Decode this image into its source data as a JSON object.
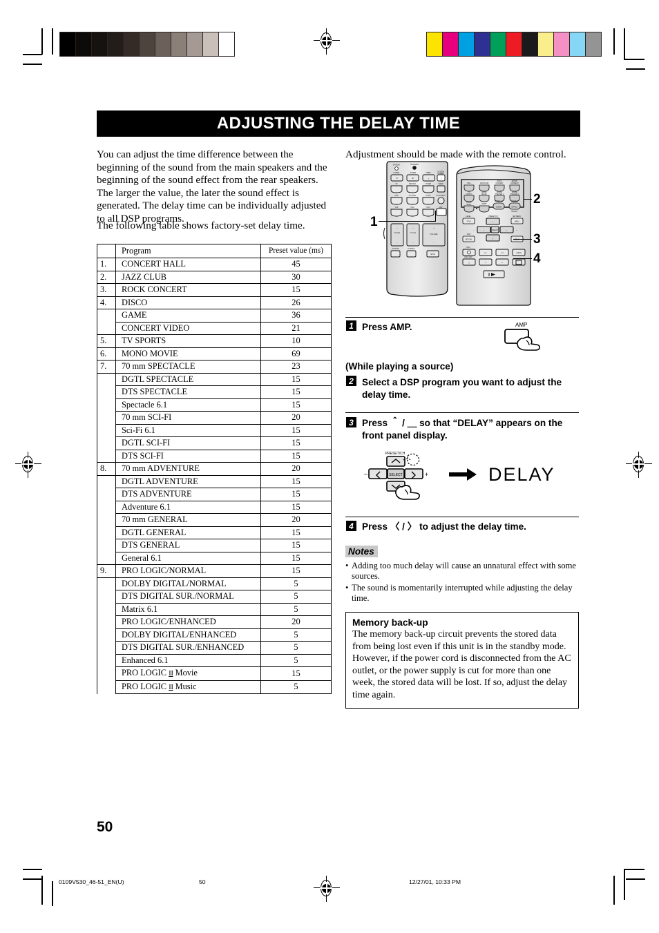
{
  "page": {
    "title": "ADJUSTING THE DELAY TIME",
    "number": "50"
  },
  "intro": {
    "paragraph1": "You can adjust the time difference between the beginning of the sound from the main speakers and the beginning of the sound effect from the rear speakers. The larger the value, the later the sound effect is generated. The delay time can be individually adjusted to all DSP programs.",
    "paragraph2": "The following table shows factory-set delay time.",
    "remote_note": "Adjustment should be made with the remote control."
  },
  "table": {
    "headers": [
      "",
      "Program",
      "Preset value (ms)"
    ],
    "rows": [
      {
        "num": "1.",
        "program": "CONCERT HALL",
        "value": "45"
      },
      {
        "num": "2.",
        "program": "JAZZ CLUB",
        "value": "30"
      },
      {
        "num": "3.",
        "program": "ROCK CONCERT",
        "value": "15"
      },
      {
        "num": "4.",
        "program": "DISCO",
        "value": "26"
      },
      {
        "num": "",
        "program": "GAME",
        "value": "36"
      },
      {
        "num": "",
        "program": "CONCERT VIDEO",
        "value": "21"
      },
      {
        "num": "5.",
        "program": "TV SPORTS",
        "value": "10"
      },
      {
        "num": "6.",
        "program": "MONO MOVIE",
        "value": "69"
      },
      {
        "num": "7.",
        "program": "70 mm SPECTACLE",
        "value": "23"
      },
      {
        "num": "",
        "program": "DGTL SPECTACLE",
        "value": "15"
      },
      {
        "num": "",
        "program": "DTS SPECTACLE",
        "value": "15"
      },
      {
        "num": "",
        "program": "Spectacle 6.1",
        "value": "15"
      },
      {
        "num": "",
        "program": "70 mm SCI-FI",
        "value": "20"
      },
      {
        "num": "",
        "program": "Sci-Fi 6.1",
        "value": "15"
      },
      {
        "num": "",
        "program": "DGTL SCI-FI",
        "value": "15"
      },
      {
        "num": "",
        "program": "DTS SCI-FI",
        "value": "15"
      },
      {
        "num": "8.",
        "program": "70 mm ADVENTURE",
        "value": "20"
      },
      {
        "num": "",
        "program": "DGTL ADVENTURE",
        "value": "15"
      },
      {
        "num": "",
        "program": "DTS ADVENTURE",
        "value": "15"
      },
      {
        "num": "",
        "program": "Adventure 6.1",
        "value": "15"
      },
      {
        "num": "",
        "program": "70 mm GENERAL",
        "value": "20"
      },
      {
        "num": "",
        "program": "DGTL GENERAL",
        "value": "15"
      },
      {
        "num": "",
        "program": "DTS GENERAL",
        "value": "15"
      },
      {
        "num": "",
        "program": "General 6.1",
        "value": "15"
      },
      {
        "num": "9.",
        "program": "PRO LOGIC/NORMAL",
        "value": "15"
      },
      {
        "num": "",
        "program": "DOLBY DIGITAL/NORMAL",
        "value": "5"
      },
      {
        "num": "",
        "program": "DTS DIGITAL SUR./NORMAL",
        "value": "5"
      },
      {
        "num": "",
        "program": "Matrix 6.1",
        "value": "5"
      },
      {
        "num": "",
        "program": "PRO LOGIC/ENHANCED",
        "value": "20"
      },
      {
        "num": "",
        "program": "DOLBY DIGITAL/ENHANCED",
        "value": "5"
      },
      {
        "num": "",
        "program": "DTS DIGITAL SUR./ENHANCED",
        "value": "5"
      },
      {
        "num": "",
        "program": "Enhanced 6.1",
        "value": "5"
      },
      {
        "num": "",
        "program": "PRO LOGIC Ⅱ Movie",
        "value": "15"
      },
      {
        "num": "",
        "program": "PRO LOGIC Ⅱ Music",
        "value": "5"
      }
    ]
  },
  "steps": {
    "step1": {
      "num": "1",
      "text": "Press AMP."
    },
    "interlude": "(While playing a source)",
    "step2": {
      "num": "2",
      "text": "Select a DSP program you want to adjust the delay time."
    },
    "step3": {
      "num": "3",
      "text": "Press ＾ / ＿ so that “DELAY” appears on the front panel display."
    },
    "step4": {
      "num": "4",
      "text": "Press 〈 / 〉 to adjust the delay time."
    }
  },
  "illustrations": {
    "amp_button_label": "AMP",
    "display_text": "DELAY",
    "cursor_pad": {
      "preset_label": "PRESET/CH",
      "select_label": "SELECT",
      "minus": "–",
      "plus": "+"
    },
    "callouts": [
      "1",
      "2",
      "3",
      "4"
    ]
  },
  "notes": {
    "heading": "Notes",
    "items": [
      "Adding too much delay will cause an unnatural effect with some sources.",
      "The sound is momentarily interrupted while adjusting the delay time."
    ]
  },
  "memory": {
    "heading": "Memory back-up",
    "body": "The memory back-up circuit prevents the stored data from being lost even if this unit is in the standby mode. However, if the power cord is disconnected from the AC outlet, or the power supply is cut for more than one week, the stored data will be lost. If so, adjust the delay time again."
  },
  "footer": {
    "filename": "0109V530_46-51_EN(U)",
    "page": "50",
    "timestamp": "12/27/01, 10:33 PM"
  },
  "calibration": {
    "gray_swatches": [
      "#000000",
      "#0d0a0a",
      "#16120f",
      "#221d19",
      "#332c26",
      "#4d443d",
      "#6b615a",
      "#8a8078",
      "#a49a93",
      "#c9c0ba",
      "#ffffff"
    ],
    "color_swatches": [
      "#fbe400",
      "#e6007e",
      "#00a0e3",
      "#2e3192",
      "#00a05a",
      "#ed1c24",
      "#1a1a1a",
      "#faee8c",
      "#f490c4",
      "#86d6f5",
      "#949494"
    ]
  }
}
